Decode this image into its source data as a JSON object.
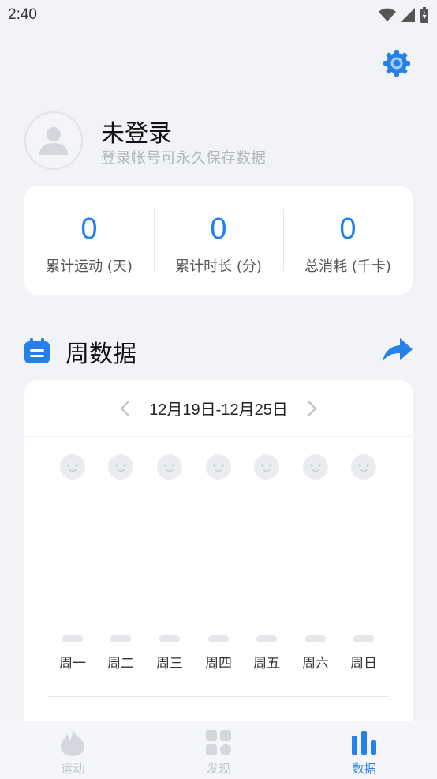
{
  "status_bar": {
    "time": "2:40"
  },
  "profile": {
    "name": "未登录",
    "subtitle": "登录帐号可永久保存数据"
  },
  "stats": [
    {
      "value": "0",
      "label": "累计运动 (天)"
    },
    {
      "value": "0",
      "label": "累计时长 (分)"
    },
    {
      "value": "0",
      "label": "总消耗 (千卡)"
    }
  ],
  "week_section": {
    "title": "周数据",
    "date_range": "12月19日-12月25日",
    "days": [
      "周一",
      "周二",
      "周三",
      "周四",
      "周五",
      "周六",
      "周日"
    ]
  },
  "bottom_nav": [
    {
      "label": "运动",
      "icon": "flame-icon",
      "active": false
    },
    {
      "label": "发现",
      "icon": "grid-icon",
      "active": false
    },
    {
      "label": "数据",
      "icon": "bar-chart-icon",
      "active": true
    }
  ],
  "colors": {
    "accent": "#2680eb",
    "background": "#f2f3f7",
    "card": "#ffffff",
    "muted": "#c3c6cd"
  },
  "icons": {
    "settings": "gear-icon",
    "avatar": "user-silhouette-icon",
    "calendar": "calendar-icon",
    "share": "share-arrow-icon",
    "prev": "chevron-left-icon",
    "next": "chevron-right-icon",
    "day_status": "neutral-face-icon"
  }
}
